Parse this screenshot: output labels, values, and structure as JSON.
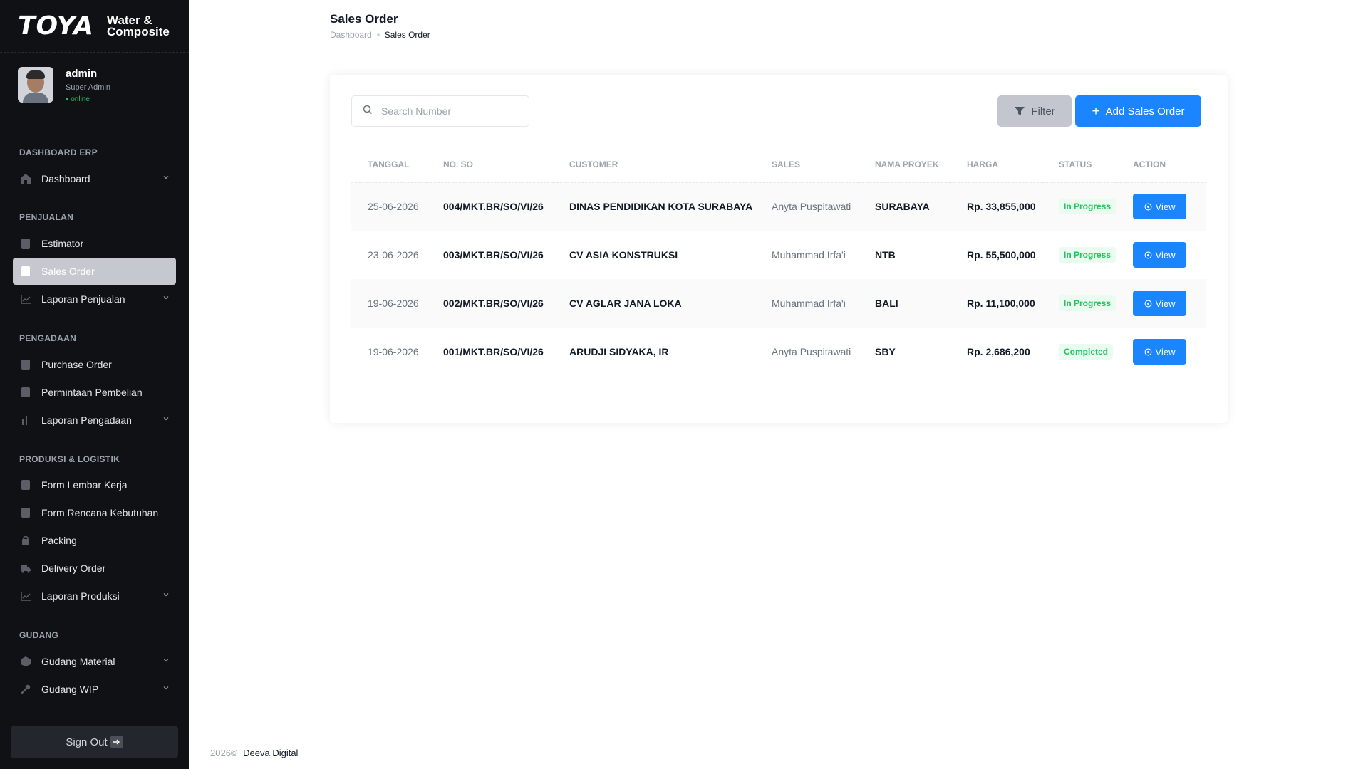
{
  "brand": {
    "logo": "TOYA",
    "subtitle_line1": "Water &",
    "subtitle_line2": "Composite"
  },
  "profile": {
    "name": "admin",
    "role": "Super Admin",
    "status": "online"
  },
  "sidebar": {
    "sections": {
      "dashboard_erp": "DASHBOARD ERP",
      "penjualan": "PENJUALAN",
      "pengadaan": "PENGADAAN",
      "produksi": "PRODUKSI & LOGISTIK",
      "gudang": "GUDANG"
    },
    "items": {
      "dashboard": "Dashboard",
      "estimator": "Estimator",
      "sales_order": "Sales Order",
      "laporan_penjualan": "Laporan Penjualan",
      "purchase_order": "Purchase Order",
      "permintaan_pembelian": "Permintaan Pembelian",
      "laporan_pengadaan": "Laporan Pengadaan",
      "form_lembar_kerja": "Form Lembar Kerja",
      "form_rencana_kebutuhan": "Form Rencana Kebutuhan",
      "packing": "Packing",
      "delivery_order": "Delivery Order",
      "laporan_produksi": "Laporan Produksi",
      "gudang_material": "Gudang Material",
      "gudang_wip": "Gudang WIP"
    },
    "active": "sales_order",
    "sign_out": "Sign Out"
  },
  "header": {
    "title": "Sales Order",
    "breadcrumb": {
      "home": "Dashboard",
      "current": "Sales Order"
    }
  },
  "toolbar": {
    "search_placeholder": "Search Number",
    "filter_label": "Filter",
    "add_label": "Add Sales Order"
  },
  "table": {
    "columns": [
      "TANGGAL",
      "NO. SO",
      "CUSTOMER",
      "SALES",
      "NAMA PROYEK",
      "HARGA",
      "STATUS",
      "ACTION"
    ],
    "rows": [
      {
        "date": "25-06-2026",
        "number": "004/MKT.BR/SO/VI/26",
        "customer": "DINAS PENDIDIKAN KOTA SURABAYA",
        "sales": "Anyta Puspitawati",
        "project": "SURABAYA",
        "price": "Rp. 33,855,000",
        "status": "In Progress",
        "action": "View"
      },
      {
        "date": "23-06-2026",
        "number": "003/MKT.BR/SO/VI/26",
        "customer": "CV ASIA KONSTRUKSI",
        "sales": "Muhammad Irfa'i",
        "project": "NTB",
        "price": "Rp. 55,500,000",
        "status": "In Progress",
        "action": "View"
      },
      {
        "date": "19-06-2026",
        "number": "002/MKT.BR/SO/VI/26",
        "customer": "CV AGLAR JANA LOKA",
        "sales": "Muhammad Irfa'i",
        "project": "BALI",
        "price": "Rp. 11,100,000",
        "status": "In Progress",
        "action": "View"
      },
      {
        "date": "19-06-2026",
        "number": "001/MKT.BR/SO/VI/26",
        "customer": "ARUDJI SIDYAKA, IR",
        "sales": "Anyta Puspitawati",
        "project": "SBY",
        "price": "Rp. 2,686,200",
        "status": "Completed",
        "action": "View"
      }
    ]
  },
  "footer": {
    "year": "2026©",
    "company": "Deeva Digital"
  },
  "colors": {
    "primary": "#1b84ff",
    "sidebar_bg": "#0f1115",
    "success": "#22c55e",
    "filter_bg": "#c3c6ce"
  }
}
